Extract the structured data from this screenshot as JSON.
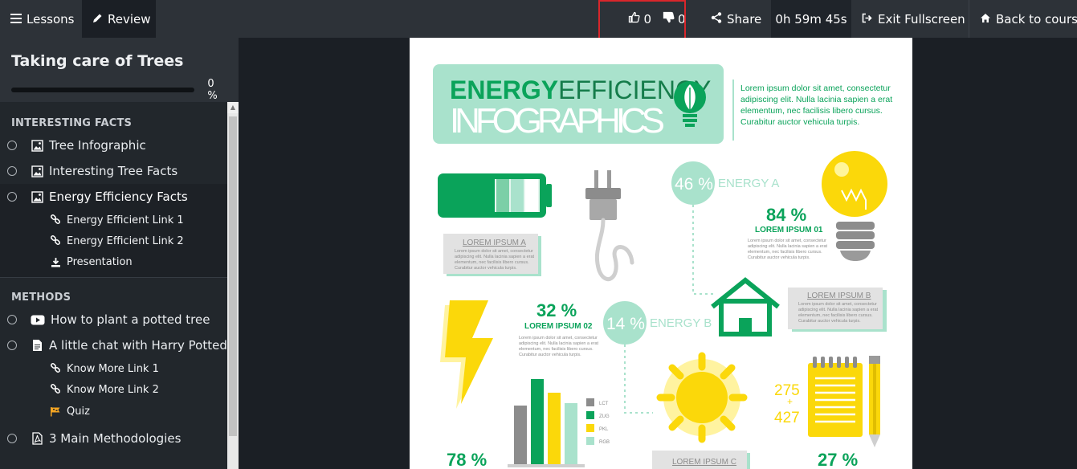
{
  "topbar": {
    "lessons_label": "Lessons",
    "review_label": "Review",
    "likes": "0",
    "dislikes": "0",
    "share_label": "Share",
    "timer": "0h 59m 45s",
    "exit_label": "Exit Fullscreen",
    "back_label": "Back to course"
  },
  "course": {
    "title": "Taking care of Trees",
    "progress": 0,
    "progress_text": "0 %"
  },
  "sections": [
    {
      "title": "INTERESTING FACTS",
      "lessons": [
        {
          "label": "Tree Infographic",
          "icon": "image-icon"
        },
        {
          "label": "Interesting Tree Facts",
          "icon": "image-icon"
        },
        {
          "label": "Energy Efficiency Facts",
          "icon": "image-icon",
          "subs": [
            {
              "label": "Energy Efficient Link 1",
              "icon": "link-icon"
            },
            {
              "label": "Energy Efficient Link 2",
              "icon": "link-icon"
            },
            {
              "label": "Presentation",
              "icon": "download-icon"
            }
          ]
        }
      ]
    },
    {
      "title": "METHODS",
      "lessons": [
        {
          "label": "How to plant a potted tree",
          "icon": "video-icon"
        },
        {
          "label": "A little chat with Harry Potted",
          "icon": "document-icon",
          "subs": [
            {
              "label": "Know More Link 1",
              "icon": "link-icon"
            },
            {
              "label": "Know More Link 2",
              "icon": "link-icon"
            },
            {
              "label": "Quiz",
              "icon": "quiz-flag-icon"
            }
          ]
        },
        {
          "label": "3 Main Methodologies",
          "icon": "pdf-icon"
        }
      ]
    }
  ],
  "infographic": {
    "title_bold": "ENERGY",
    "title_light": "EFFICIENCY",
    "title_big": "INFOGRAPHICS",
    "intro": [
      "Lorem ipsum dolor sit amet, consectetur",
      "adipiscing elit. Nulla lacinia sapien a erat",
      "elementum, nec facilisis libero cursus.",
      "Curabitur auctor vehicula turpis."
    ],
    "lorem_a": "LOREM IPSUM A",
    "lorem_b": "LOREM IPSUM B",
    "lorem_c": "LOREM IPSUM C",
    "small_text": [
      "Lorem ipsum dolor sit amet, consectetur",
      "adipiscing elit. Nulla lacinia sapien a erat",
      "elementum, nec facilisis libero cursus.",
      "Curabitur auctor vehicula turpis."
    ],
    "energy_a_pct": "46 %",
    "energy_a_label": "ENERGY A",
    "energy_b_pct": "14 %",
    "energy_b_label": "ENERGY B",
    "stat_84": "84 %",
    "stat_84_label": "LOREM IPSUM 01",
    "stat_32": "32 %",
    "stat_32_label": "LOREM IPSUM 02",
    "stat_78": "78 %",
    "stat_27": "27 %",
    "num_275": "275",
    "plus": "+",
    "num_427": "427",
    "legend": [
      "LCT",
      "ZUG",
      "PKL",
      "RGB"
    ],
    "colors": {
      "green": "#0aa35a",
      "mint": "#a9e2cc",
      "yellow": "#fbd80a",
      "gray": "#8c8c8c"
    }
  }
}
